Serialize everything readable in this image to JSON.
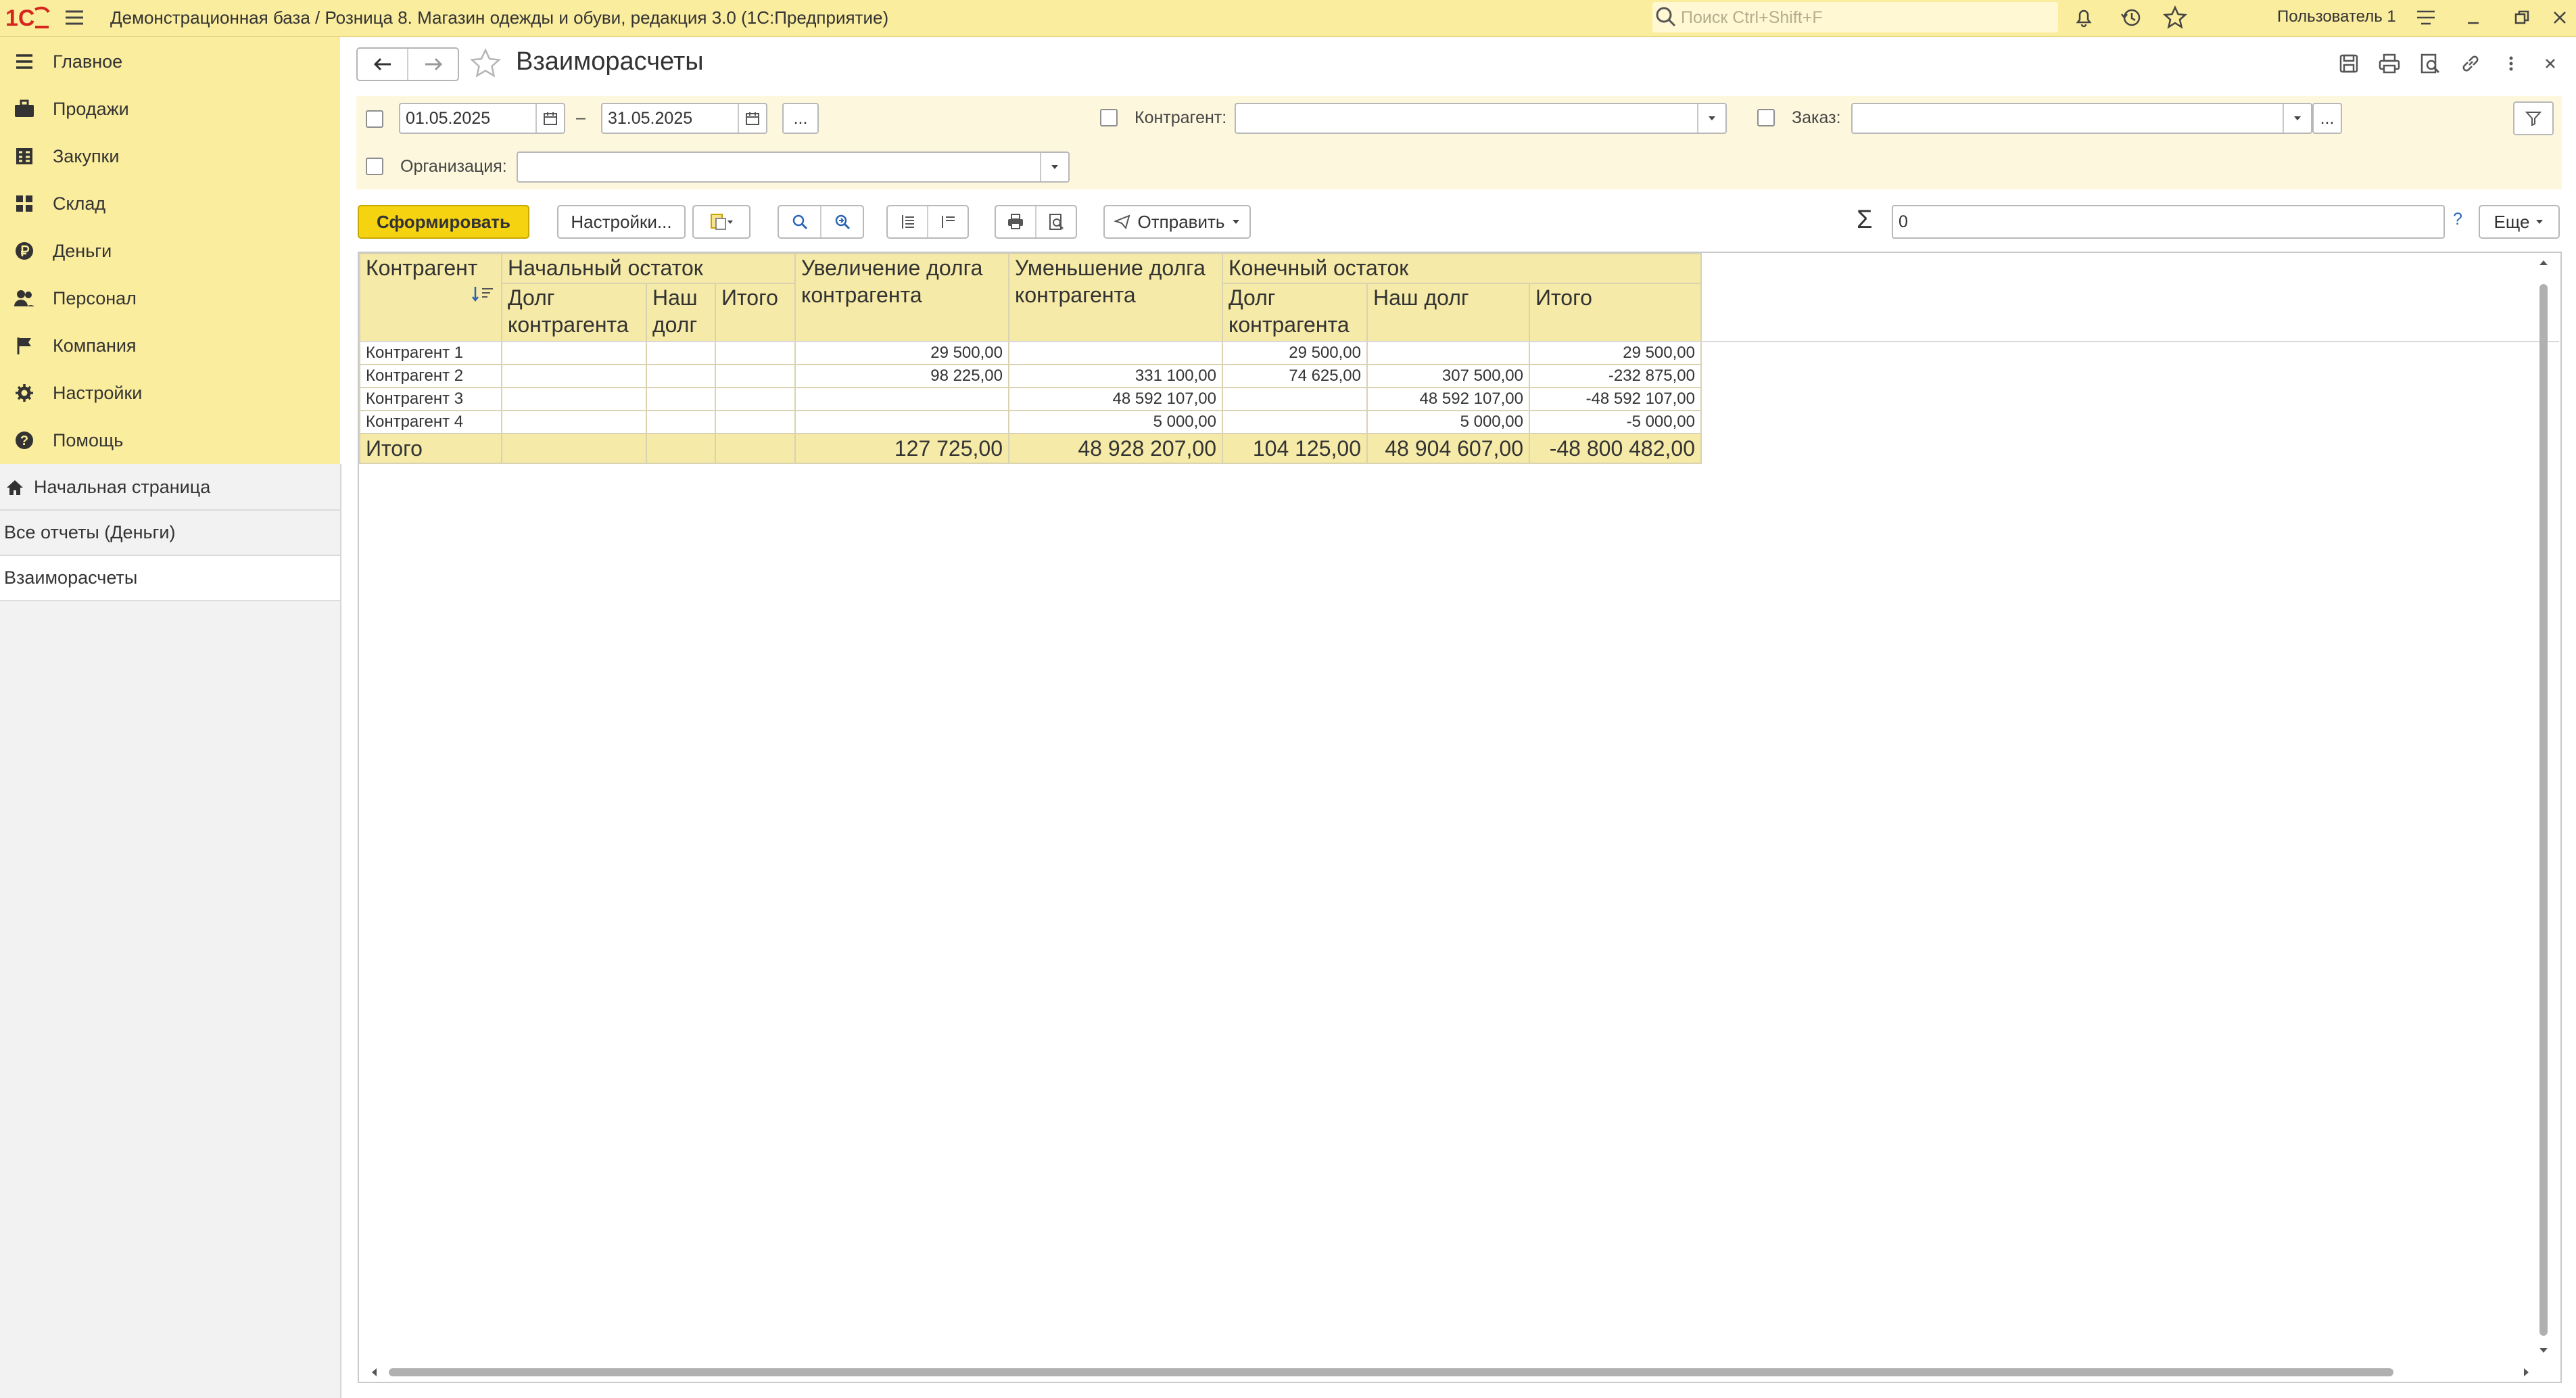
{
  "app": {
    "title": "Демонстрационная база / Розница 8. Магазин одежды и обуви, редакция 3.0  (1С:Предприятие)",
    "search_placeholder": "Поиск Ctrl+Shift+F",
    "user": "Пользователь 1",
    "accent_color": "#fbed9e",
    "logo_color": "#d7261e"
  },
  "sidebar": {
    "sections": [
      {
        "label": "Главное",
        "icon": "menu-icon"
      },
      {
        "label": "Продажи",
        "icon": "briefcase-icon"
      },
      {
        "label": "Закупки",
        "icon": "calculator-icon"
      },
      {
        "label": "Склад",
        "icon": "grid-icon"
      },
      {
        "label": "Деньги",
        "icon": "ruble-icon"
      },
      {
        "label": "Персонал",
        "icon": "people-icon"
      },
      {
        "label": "Компания",
        "icon": "flag-icon"
      },
      {
        "label": "Настройки",
        "icon": "gear-icon"
      },
      {
        "label": "Помощь",
        "icon": "help-icon"
      }
    ],
    "open_windows": [
      {
        "label": "Начальная страница",
        "icon": "home-icon"
      },
      {
        "label": "Все отчеты (Деньги)"
      },
      {
        "label": "Взаиморасчеты",
        "active": true
      }
    ]
  },
  "form": {
    "title": "Взаиморасчеты",
    "period_from": "01.05.2025",
    "period_dash": "–",
    "period_to": "31.05.2025",
    "ellipsis": "...",
    "counterparty_label": "Контрагент:",
    "counterparty_value": "",
    "order_label": "Заказ:",
    "order_value": "",
    "organization_label": "Организация:",
    "organization_value": ""
  },
  "toolbar": {
    "generate_label": "Сформировать",
    "settings_label": "Настройки...",
    "send_label": "Отправить",
    "sum_symbol": "Σ",
    "sum_value": "0",
    "help_mark": "?",
    "more_label": "Еще"
  },
  "report": {
    "header": {
      "counterparty": "Контрагент",
      "opening_balance": "Начальный остаток",
      "debt_increase": "Увеличение долга контрагента",
      "debt_decrease": "Уменьшение долга контрагента",
      "closing_balance": "Конечный остаток",
      "counterparty_debt": "Долг контрагента",
      "our_debt_short": "Наш долг",
      "our_debt": "Наш долг",
      "total": "Итого"
    },
    "rows": [
      {
        "name": "Контрагент 1",
        "open_cp": "",
        "open_our": "",
        "open_total": "",
        "increase": "29 500,00",
        "decrease": "",
        "close_cp": "29 500,00",
        "close_our": "",
        "close_total": "29 500,00"
      },
      {
        "name": "Контрагент 2",
        "open_cp": "",
        "open_our": "",
        "open_total": "",
        "increase": "98 225,00",
        "decrease": "331 100,00",
        "close_cp": "74 625,00",
        "close_our": "307 500,00",
        "close_total": "-232 875,00"
      },
      {
        "name": "Контрагент 3",
        "open_cp": "",
        "open_our": "",
        "open_total": "",
        "increase": "",
        "decrease": "48 592 107,00",
        "close_cp": "",
        "close_our": "48 592 107,00",
        "close_total": "-48 592 107,00"
      },
      {
        "name": "Контрагент 4",
        "open_cp": "",
        "open_our": "",
        "open_total": "",
        "increase": "",
        "decrease": "5 000,00",
        "close_cp": "",
        "close_our": "5 000,00",
        "close_total": "-5 000,00"
      }
    ],
    "totals": {
      "name": "Итого",
      "open_cp": "",
      "open_our": "",
      "open_total": "",
      "increase": "127 725,00",
      "decrease": "48 928 207,00",
      "close_cp": "104 125,00",
      "close_our": "48 904 607,00",
      "close_total": "-48 800 482,00"
    }
  }
}
